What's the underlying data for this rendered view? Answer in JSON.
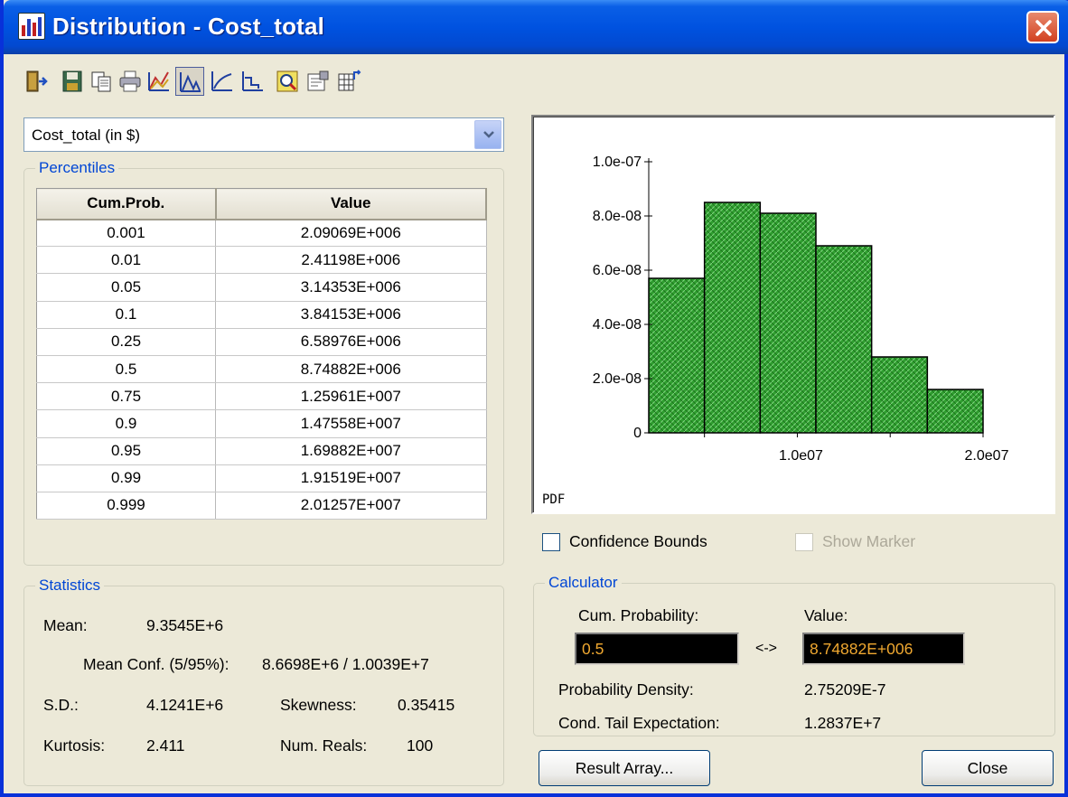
{
  "window": {
    "title": "Distribution - Cost_total"
  },
  "toolbar": {
    "icons": [
      "exit-icon",
      "save-icon",
      "copy-icon",
      "print-icon",
      "chart-settings-icon",
      "pdf-view-icon",
      "cdf-view-icon",
      "step-view-icon",
      "zoom-icon",
      "properties-icon",
      "export-table-icon"
    ]
  },
  "variable": {
    "selected": "Cost_total (in $)"
  },
  "percentiles": {
    "legend": "Percentiles",
    "columns": [
      "Cum.Prob.",
      "Value"
    ],
    "rows": [
      [
        "0.001",
        "2.09069E+006"
      ],
      [
        "0.01",
        "2.41198E+006"
      ],
      [
        "0.05",
        "3.14353E+006"
      ],
      [
        "0.1",
        "3.84153E+006"
      ],
      [
        "0.25",
        "6.58976E+006"
      ],
      [
        "0.5",
        "8.74882E+006"
      ],
      [
        "0.75",
        "1.25961E+007"
      ],
      [
        "0.9",
        "1.47558E+007"
      ],
      [
        "0.95",
        "1.69882E+007"
      ],
      [
        "0.99",
        "1.91519E+007"
      ],
      [
        "0.999",
        "2.01257E+007"
      ]
    ]
  },
  "statistics": {
    "legend": "Statistics",
    "mean_label": "Mean:",
    "mean_value": "9.3545E+6",
    "mean_conf_label": "Mean Conf. (5/95%):",
    "mean_conf_value": "8.6698E+6 / 1.0039E+7",
    "sd_label": "S.D.:",
    "sd_value": "4.1241E+6",
    "skewness_label": "Skewness:",
    "skewness_value": "0.35415",
    "kurtosis_label": "Kurtosis:",
    "kurtosis_value": "2.411",
    "num_reals_label": "Num. Reals:",
    "num_reals_value": "100"
  },
  "chart_data": {
    "type": "bar",
    "bins": [
      {
        "x0": 2000000,
        "x1": 5000000,
        "density": 5.7e-08
      },
      {
        "x0": 5000000,
        "x1": 8000000,
        "density": 8.5e-08
      },
      {
        "x0": 8000000,
        "x1": 11000000,
        "density": 8.1e-08
      },
      {
        "x0": 11000000,
        "x1": 14000000,
        "density": 6.9e-08
      },
      {
        "x0": 14000000,
        "x1": 17000000,
        "density": 2.8e-08
      },
      {
        "x0": 17000000,
        "x1": 20000000,
        "density": 1.6e-08
      }
    ],
    "xlim": [
      2000000,
      20000000
    ],
    "ylim": [
      0,
      1e-07
    ],
    "x_ticks": [
      5000000,
      10000000,
      15000000,
      20000000
    ],
    "x_tick_labels": [
      {
        "value": 10000000,
        "label": "1.0e07"
      },
      {
        "value": 20000000,
        "label": "2.0e07"
      }
    ],
    "y_ticks": [
      {
        "value": 1e-07,
        "label": "1.0e-07"
      },
      {
        "value": 8e-08,
        "label": "8.0e-08"
      },
      {
        "value": 6e-08,
        "label": "6.0e-08"
      },
      {
        "value": 4e-08,
        "label": "4.0e-08"
      },
      {
        "value": 2e-08,
        "label": "2.0e-08"
      },
      {
        "value": 0,
        "label": "0"
      }
    ],
    "ylabel": "PDF",
    "bar_color": "#2f9e2f",
    "grid": false
  },
  "options": {
    "confidence_bounds": "Confidence Bounds",
    "show_marker": "Show Marker"
  },
  "calculator": {
    "legend": "Calculator",
    "cum_prob_label": "Cum. Probability:",
    "value_label": "Value:",
    "cum_prob_value": "0.5",
    "value_value": "8.74882E+006",
    "arrow": "<->",
    "density_label": "Probability Density:",
    "density_value": "2.75209E-7",
    "cte_label": "Cond. Tail Expectation:",
    "cte_value": "1.2837E+7"
  },
  "buttons": {
    "result_array": "Result Array...",
    "close": "Close"
  }
}
